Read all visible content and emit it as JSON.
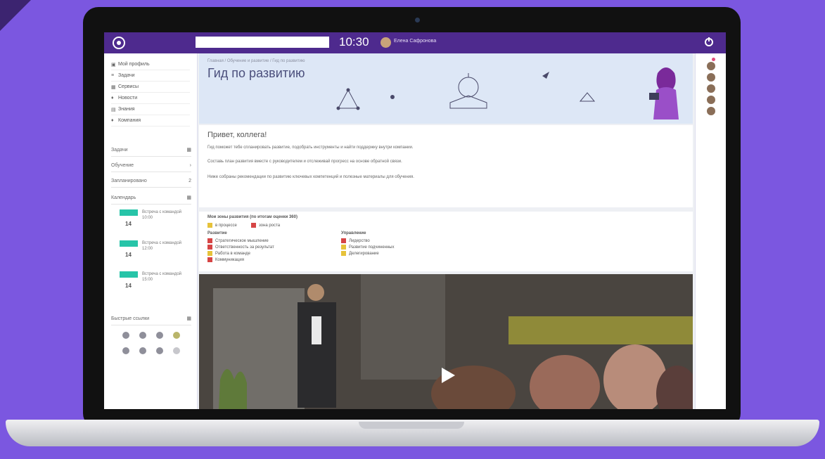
{
  "topbar": {
    "time": "10:30",
    "search_placeholder": "",
    "user_name": "Елена Сафронова"
  },
  "sidebar": {
    "nav": [
      {
        "label": "Мой профиль",
        "icon": "user-icon"
      },
      {
        "label": "Задачи",
        "icon": "list-icon"
      },
      {
        "label": "Сервисы",
        "icon": "grid-icon"
      },
      {
        "label": "Новости",
        "icon": "bell-icon"
      },
      {
        "label": "Знания",
        "icon": "book-icon"
      },
      {
        "label": "Компания",
        "icon": "building-icon"
      }
    ],
    "cards": [
      {
        "label": "Задачи",
        "value": ""
      },
      {
        "label": "Обучение",
        "value": ""
      },
      {
        "label": "Запланировано",
        "value": "2"
      },
      {
        "label": "Календарь",
        "value": ""
      }
    ],
    "events": [
      {
        "num": "14",
        "title": "Встреча с командой",
        "sub": "10:00"
      },
      {
        "num": "14",
        "title": "Встреча с командой",
        "sub": "12:00"
      },
      {
        "num": "14",
        "title": "Встреча с командой",
        "sub": "15:00"
      }
    ],
    "quick_links_title": "Быстрые ссылки"
  },
  "main": {
    "breadcrumb": "Главная / Обучение и развитие / Гид по развитию",
    "title": "Гид по развитию",
    "greeting": "Привет, коллега!",
    "paragraphs": [
      "Гид поможет тебе спланировать развитие, подобрать инструменты и найти поддержку внутри компании.",
      "Составь план развития вместе с руководителем и отслеживай прогресс на основе обратной связи.",
      "Ниже собраны рекомендации по развитию ключевых компетенций и полезные материалы для обучения."
    ],
    "assessment": {
      "title": "Мои зоны развития (по итогам оценки 360)",
      "legend": [
        {
          "label": "в процессе",
          "color": "#e6c23a"
        },
        {
          "label": "зона роста",
          "color": "#d64545"
        }
      ],
      "groups": [
        {
          "title": "Развитие",
          "items": [
            {
              "label": "Стратегическое мышление",
              "color": "#d64545"
            },
            {
              "label": "Ответственность за результат",
              "color": "#d64545"
            },
            {
              "label": "Работа в команде",
              "color": "#e6c23a"
            },
            {
              "label": "Коммуникация",
              "color": "#d64545"
            }
          ]
        },
        {
          "title": "Управление",
          "items": [
            {
              "label": "Лидерство",
              "color": "#d64545"
            },
            {
              "label": "Развитие подчиненных",
              "color": "#e6c23a"
            },
            {
              "label": "Делегирование",
              "color": "#e6c23a"
            }
          ]
        }
      ]
    }
  },
  "rail": {
    "avatars": 5
  }
}
